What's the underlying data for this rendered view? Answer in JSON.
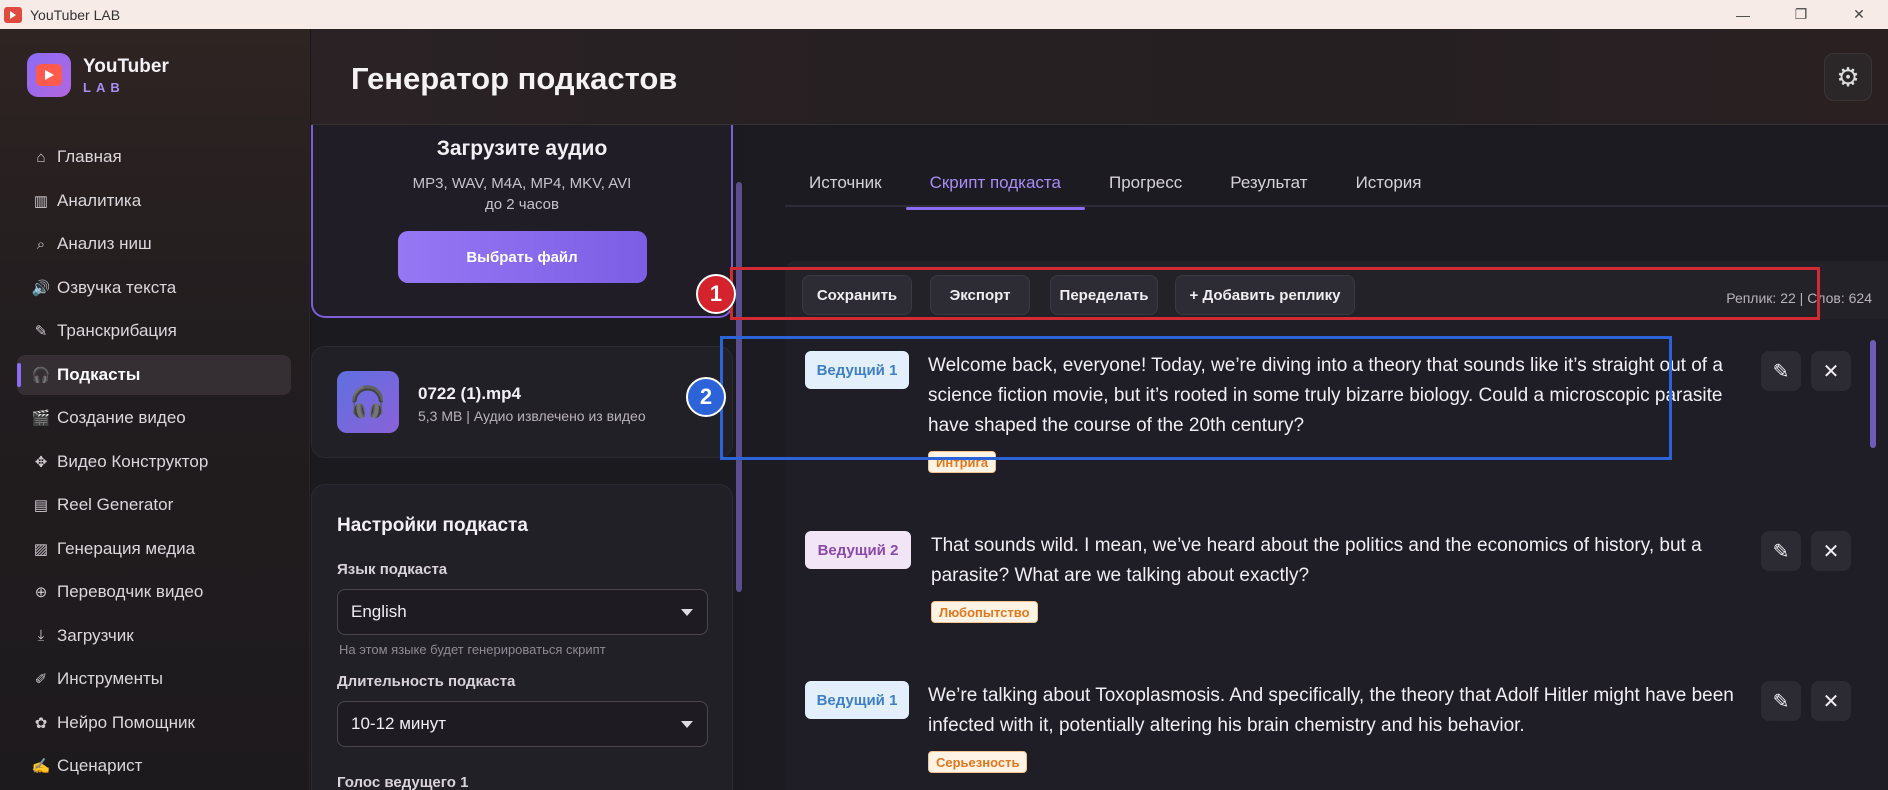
{
  "window": {
    "title": "YouTuber LAB",
    "buttons": [
      "—",
      "❐",
      "✕"
    ]
  },
  "brand": {
    "name": "YouTuber",
    "sub": "LAB"
  },
  "nav": [
    {
      "label": "Главная",
      "icon": "home-icon",
      "glyph": "⌂"
    },
    {
      "label": "Аналитика",
      "icon": "chart-icon",
      "glyph": "▥"
    },
    {
      "label": "Анализ ниш",
      "icon": "search-icon",
      "glyph": "⌕"
    },
    {
      "label": "Озвучка текста",
      "icon": "speaker-icon",
      "glyph": "🔊"
    },
    {
      "label": "Транскрибация",
      "icon": "transcribe-icon",
      "glyph": "✎"
    },
    {
      "label": "Подкасты",
      "icon": "headphones-icon",
      "glyph": "🎧"
    },
    {
      "label": "Создание видео",
      "icon": "video-icon",
      "glyph": "🎬"
    },
    {
      "label": "Видео Конструктор",
      "icon": "puzzle-icon",
      "glyph": "✥"
    },
    {
      "label": "Reel Generator",
      "icon": "film-icon",
      "glyph": "▤"
    },
    {
      "label": "Генерация медиа",
      "icon": "image-icon",
      "glyph": "▨"
    },
    {
      "label": "Переводчик видео",
      "icon": "globe-icon",
      "glyph": "⊕"
    },
    {
      "label": "Загрузчик",
      "icon": "download-icon",
      "glyph": "⤓"
    },
    {
      "label": "Инструменты",
      "icon": "wrench-icon",
      "glyph": "✐"
    },
    {
      "label": "Нейро Помощник",
      "icon": "brain-icon",
      "glyph": "✿"
    },
    {
      "label": "Сценарист",
      "icon": "script-icon",
      "glyph": "✍"
    }
  ],
  "active_nav_index": 5,
  "header": {
    "title": "Генератор подкастов",
    "settings_icon": "gear-icon"
  },
  "upload": {
    "title": "Загрузите аудио",
    "formats": "MP3, WAV, M4A, MP4, MKV, AVI",
    "duration": "до 2 часов",
    "button": "Выбрать файл"
  },
  "file": {
    "name": "0722 (1).mp4",
    "meta": "5,3 MB | Аудио извлечено из видео"
  },
  "settings": {
    "title": "Настройки подкаста",
    "language_label": "Язык подкаста",
    "language_value": "English",
    "language_hint": "На этом языке будет генерироваться скрипт",
    "duration_label": "Длительность подкаста",
    "duration_value": "10-12 минут",
    "voice1_label": "Голос ведущего 1"
  },
  "tabs": [
    "Источник",
    "Скрипт подкаста",
    "Прогресс",
    "Результат",
    "История"
  ],
  "active_tab_index": 1,
  "toolbar": {
    "save": "Сохранить",
    "export": "Экспорт",
    "redo": "Переделать",
    "add": "+ Добавить реплику",
    "stats": "Реплик: 22  | Слов: 624"
  },
  "markers": [
    "1",
    "2"
  ],
  "lines": [
    {
      "speaker": "Ведущий 1",
      "text": "Welcome back, everyone! Today, we’re diving into a theory that sounds like it’s straight out of a science fiction movie, but it’s rooted in some truly bizarre biology. Could a microscopic parasite have shaped the course of the 20th century?",
      "emotion": "Интрига"
    },
    {
      "speaker": "Ведущий 2",
      "text": "That sounds wild. I mean, we’ve heard about the politics and the economics of history, but a parasite? What are we talking about exactly?",
      "emotion": "Любопытство"
    },
    {
      "speaker": "Ведущий 1",
      "text": "We’re talking about Toxoplasmosis. And specifically, the theory that Adolf Hitler might have been infected with it, potentially altering his brain chemistry and his behavior.",
      "emotion": "Серьезность"
    }
  ],
  "line_actions": {
    "edit": "✎",
    "delete": "✕"
  }
}
